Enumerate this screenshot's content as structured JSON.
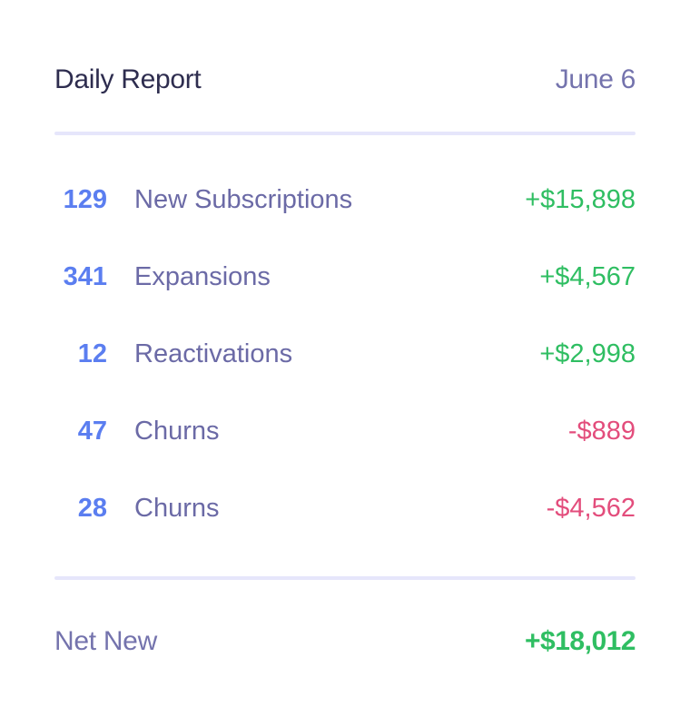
{
  "header": {
    "title": "Daily Report",
    "date": "June 6"
  },
  "rows": [
    {
      "count": "129",
      "label": "New Subscriptions",
      "amount": "+$15,898",
      "sign": "positive"
    },
    {
      "count": "341",
      "label": "Expansions",
      "amount": "+$4,567",
      "sign": "positive"
    },
    {
      "count": "12",
      "label": "Reactivations",
      "amount": "+$2,998",
      "sign": "positive"
    },
    {
      "count": "47",
      "label": "Churns",
      "amount": "-$889",
      "sign": "negative"
    },
    {
      "count": "28",
      "label": "Churns",
      "amount": "-$4,562",
      "sign": "negative"
    }
  ],
  "footer": {
    "label": "Net New",
    "value": "+$18,012"
  },
  "colors": {
    "title": "#2e2d4f",
    "muted": "#7473ad",
    "count": "#5b7ef0",
    "positive": "#2fbe62",
    "negative": "#e34d7c",
    "divider": "#e6e6fb"
  }
}
